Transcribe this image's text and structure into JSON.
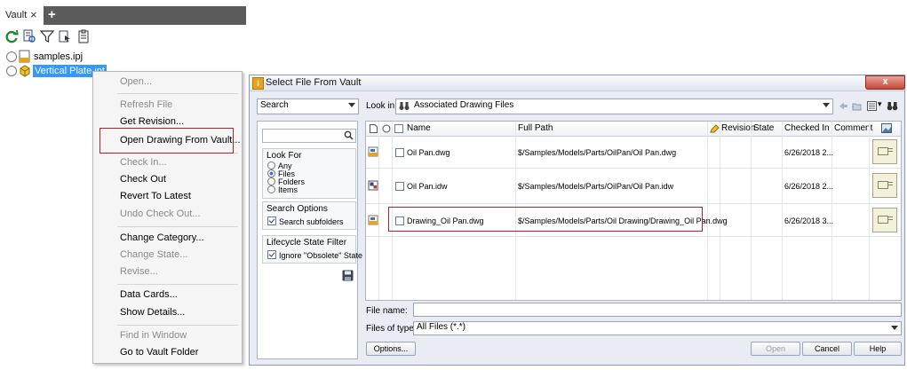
{
  "vault": {
    "tab_label": "Vault",
    "tab_close": "×",
    "add_tab": "+",
    "tree": [
      {
        "name": "samples.ipj"
      },
      {
        "name": "Vertical Plate.ipt"
      }
    ]
  },
  "context_menu": {
    "items": [
      {
        "label": "Open...",
        "enabled": false
      },
      {
        "label": "Refresh File",
        "enabled": false
      },
      {
        "label": "Get Revision...",
        "enabled": true
      },
      {
        "label": "Open Drawing From Vault...",
        "enabled": true
      },
      {
        "label": "Check In...",
        "enabled": false
      },
      {
        "label": "Check Out",
        "enabled": true
      },
      {
        "label": "Revert To Latest",
        "enabled": true
      },
      {
        "label": "Undo Check Out...",
        "enabled": false
      },
      {
        "label": "Change Category...",
        "enabled": true
      },
      {
        "label": "Change State...",
        "enabled": false
      },
      {
        "label": "Revise...",
        "enabled": false
      },
      {
        "label": "Data Cards...",
        "enabled": true
      },
      {
        "label": "Show Details...",
        "enabled": true
      },
      {
        "label": "Find in Window",
        "enabled": false
      },
      {
        "label": "Go to Vault Folder",
        "enabled": true
      }
    ],
    "highlight_color": "#b3202a"
  },
  "dialog": {
    "title": "Select File From Vault",
    "close_label": "x",
    "search_mode": "Search",
    "look_in_label": "Look in:",
    "look_in_value": "Associated Drawing Files",
    "look_for": {
      "title": "Look For",
      "options": [
        "Any",
        "Files",
        "Folders",
        "Items"
      ],
      "selected": "Files"
    },
    "search_options": {
      "title": "Search Options",
      "subfolders_label": "Search subfolders",
      "subfolders_checked": true
    },
    "lifecycle": {
      "title": "Lifecycle State Filter",
      "ignore_label": "Ignore \"Obsolete\" State",
      "ignore_checked": true
    },
    "columns": {
      "name": "Name",
      "full_path": "Full Path",
      "revision": "Revision",
      "state": "State",
      "checked_in": "Checked In",
      "comment": "Comment"
    },
    "rows": [
      {
        "name": "Oil Pan.dwg",
        "path": "$/Samples/Models/Parts/OilPan/Oil Pan.dwg",
        "revision": "",
        "state": "",
        "checked_in": "6/26/2018 2...",
        "comment": ""
      },
      {
        "name": "Oil Pan.idw",
        "path": "$/Samples/Models/Parts/OilPan/Oil Pan.idw",
        "revision": "",
        "state": "",
        "checked_in": "6/26/2018 2...",
        "comment": ""
      },
      {
        "name": "Drawing_Oil Pan.dwg",
        "path": "$/Samples/Models/Parts/Oil Drawing/Drawing_Oil Pan.dwg",
        "revision": "",
        "state": "",
        "checked_in": "6/26/2018 3...",
        "comment": ""
      }
    ],
    "file_name_label": "File name:",
    "file_name_value": "",
    "file_type_label": "Files of type:",
    "file_type_value": "All Files (*.*)",
    "buttons": {
      "options": "Options...",
      "open": "Open",
      "cancel": "Cancel",
      "help": "Help"
    }
  }
}
